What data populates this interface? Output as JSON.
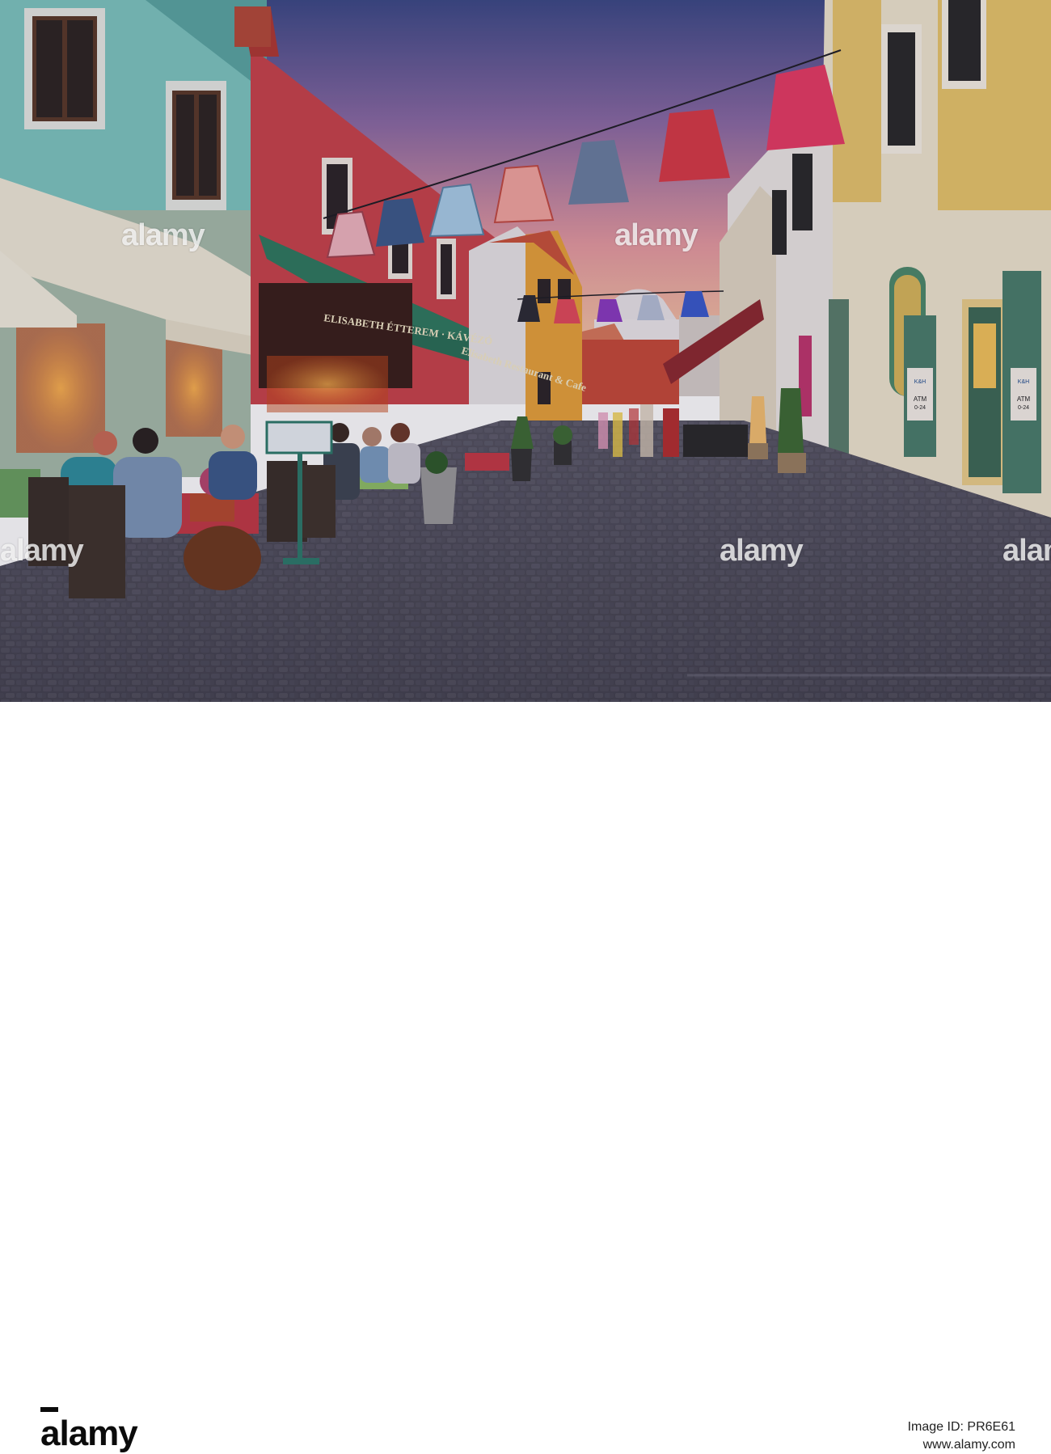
{
  "watermark": {
    "text": "alamy"
  },
  "signs": {
    "awning_top": "ELISABETH ÉTTEREM · KÁVÉZÓ",
    "awning_main": "Elisabeth Restaurant & Cafe",
    "atm_label": "ATM",
    "atm_hours": "0-24",
    "atm_brand": "K&H"
  },
  "footer": {
    "logo": "alamy",
    "image_id_line": "Image ID: PR6E61",
    "site": "www.alamy.com"
  }
}
